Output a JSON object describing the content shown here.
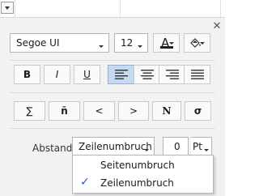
{
  "font": {
    "family": "Segoe UI",
    "size": "12"
  },
  "font_color_glyph": "A",
  "format": {
    "bold": "B",
    "italic": "I",
    "underline": "U"
  },
  "alignment": {
    "active": "left"
  },
  "symbols": [
    "∑",
    "n̄",
    "<",
    ">",
    "N",
    "σ"
  ],
  "spacing": {
    "label": "Abstand",
    "type": "Zeilenumbruch",
    "value": "0",
    "unit": "Pt"
  },
  "dropdown": {
    "options": [
      {
        "label": "Seitenumbruch",
        "checked": false
      },
      {
        "label": "Zeilenumbruch",
        "checked": true
      }
    ]
  },
  "colors": {
    "selected_align_bg": "#c5d9f1",
    "panel_bg": "#f2f2f2",
    "check_color": "#1f5fbf"
  },
  "icons": {
    "close": "close-icon",
    "fill": "paint-bucket-icon"
  }
}
